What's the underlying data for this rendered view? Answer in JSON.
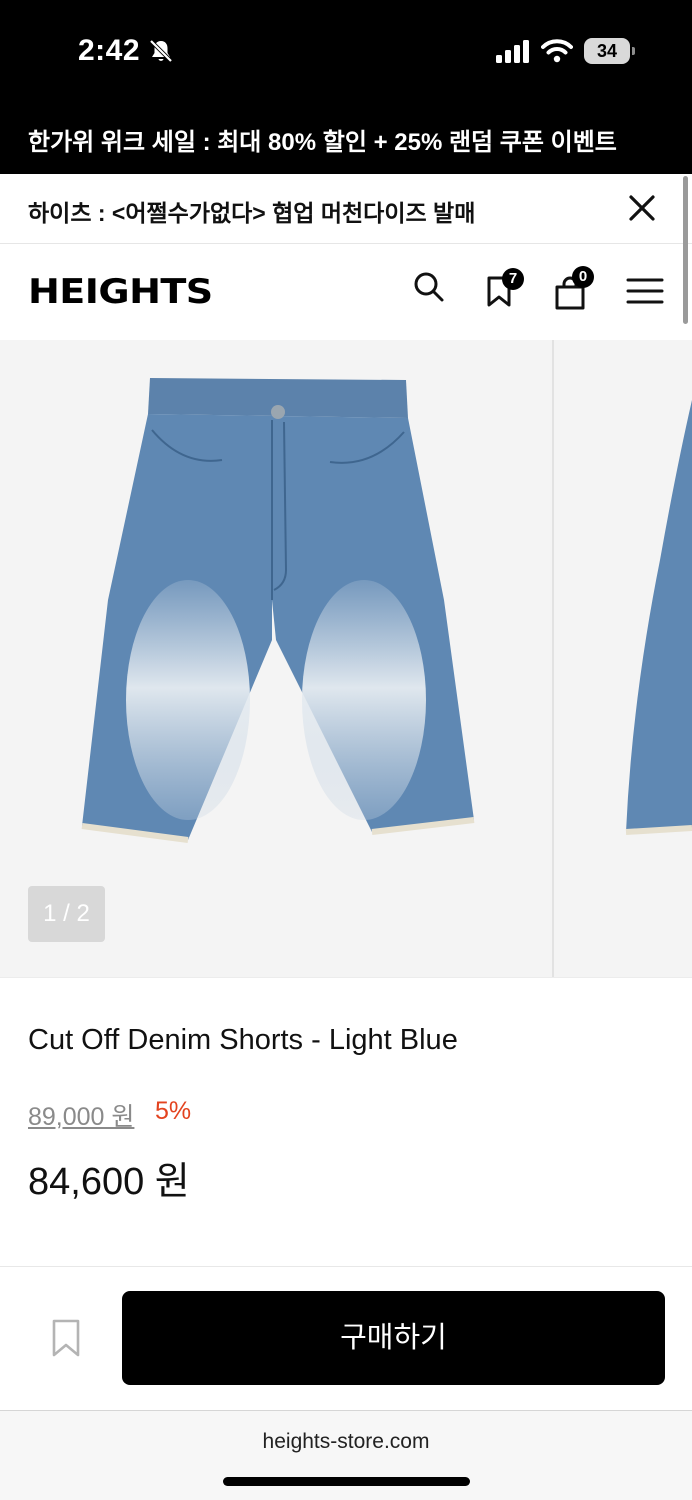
{
  "status_bar": {
    "time": "2:42",
    "battery": "34",
    "icons": [
      "bell-slash-icon",
      "cellular-signal-icon",
      "wifi-icon",
      "battery-icon"
    ]
  },
  "promo_banner": {
    "text": "한가위 위크 세일 : 최대 80% 할인 + 25% 랜덤 쿠폰 이벤트"
  },
  "announcement": {
    "text": "하이츠 : <어쩔수가없다> 협업 머천다이즈 발매",
    "close_icon": "close-icon"
  },
  "header": {
    "logo": "HEIGHTS",
    "wishlist_count": "7",
    "cart_count": "0",
    "icons": [
      "search-icon",
      "bookmark-icon",
      "shopping-bag-icon",
      "menu-icon"
    ]
  },
  "gallery": {
    "counter": "1 / 2",
    "current_slide": 1,
    "total_slides": 2
  },
  "product": {
    "name": "Cut Off Denim Shorts - Light Blue",
    "original_price": "89,000 원",
    "discount": "5%",
    "sale_price": "84,600 원"
  },
  "buy_bar": {
    "buy_label": "구매하기",
    "bookmark_icon": "bookmark-icon"
  },
  "browser": {
    "url": "heights-store.com"
  },
  "colors": {
    "discount": "#e3431f",
    "primary": "#000000",
    "gallery_bg": "#f4f4f4"
  }
}
